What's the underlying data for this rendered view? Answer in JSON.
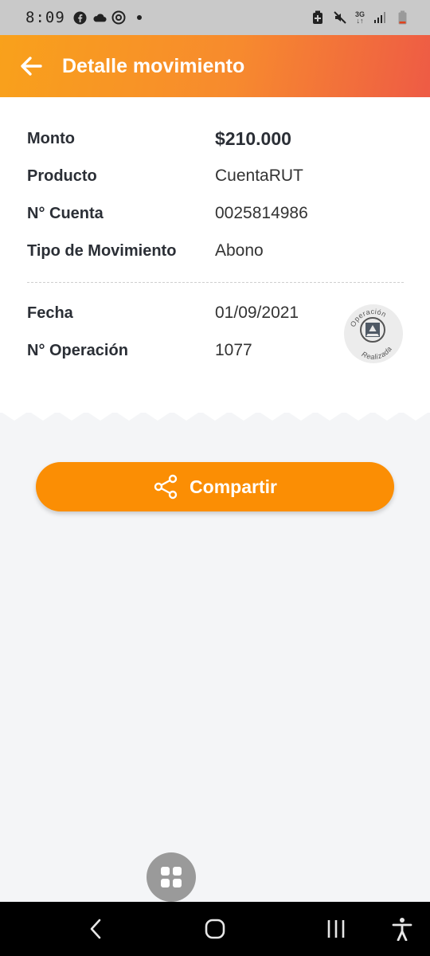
{
  "status_bar": {
    "time": "8:09",
    "network_label_top": "3G",
    "icons_left": [
      "facebook-icon",
      "cloud-icon",
      "threads-icon",
      "notification-dot"
    ],
    "icons_right": [
      "battery-saver-icon",
      "mute-icon",
      "network-3g-icon",
      "signal-icon",
      "battery-icon"
    ]
  },
  "header": {
    "title": "Detalle movimiento",
    "back_icon": "arrow-left-icon",
    "gradient_colors": [
      "#f9a11b",
      "#ee5b45"
    ]
  },
  "details": [
    {
      "label": "Monto",
      "value": "$210.000"
    },
    {
      "label": "Producto",
      "value": "CuentaRUT"
    },
    {
      "label": "N° Cuenta",
      "value": "0025814986"
    },
    {
      "label": "Tipo de Movimiento",
      "value": "Abono"
    }
  ],
  "operation": [
    {
      "label": "Fecha",
      "value": "01/09/2021"
    },
    {
      "label": "N° Operación",
      "value": "1077"
    }
  ],
  "stamp": {
    "text_top": "Operación",
    "text_bottom": "Realizada"
  },
  "share_button": {
    "label": "Compartir",
    "icon": "share-icon",
    "color": "#fb8e04"
  },
  "fab": {
    "icon": "grid-menu-icon"
  },
  "nav_bar": {
    "buttons": [
      "back-nav-icon",
      "home-nav-icon",
      "recents-nav-icon",
      "accessibility-icon"
    ]
  }
}
